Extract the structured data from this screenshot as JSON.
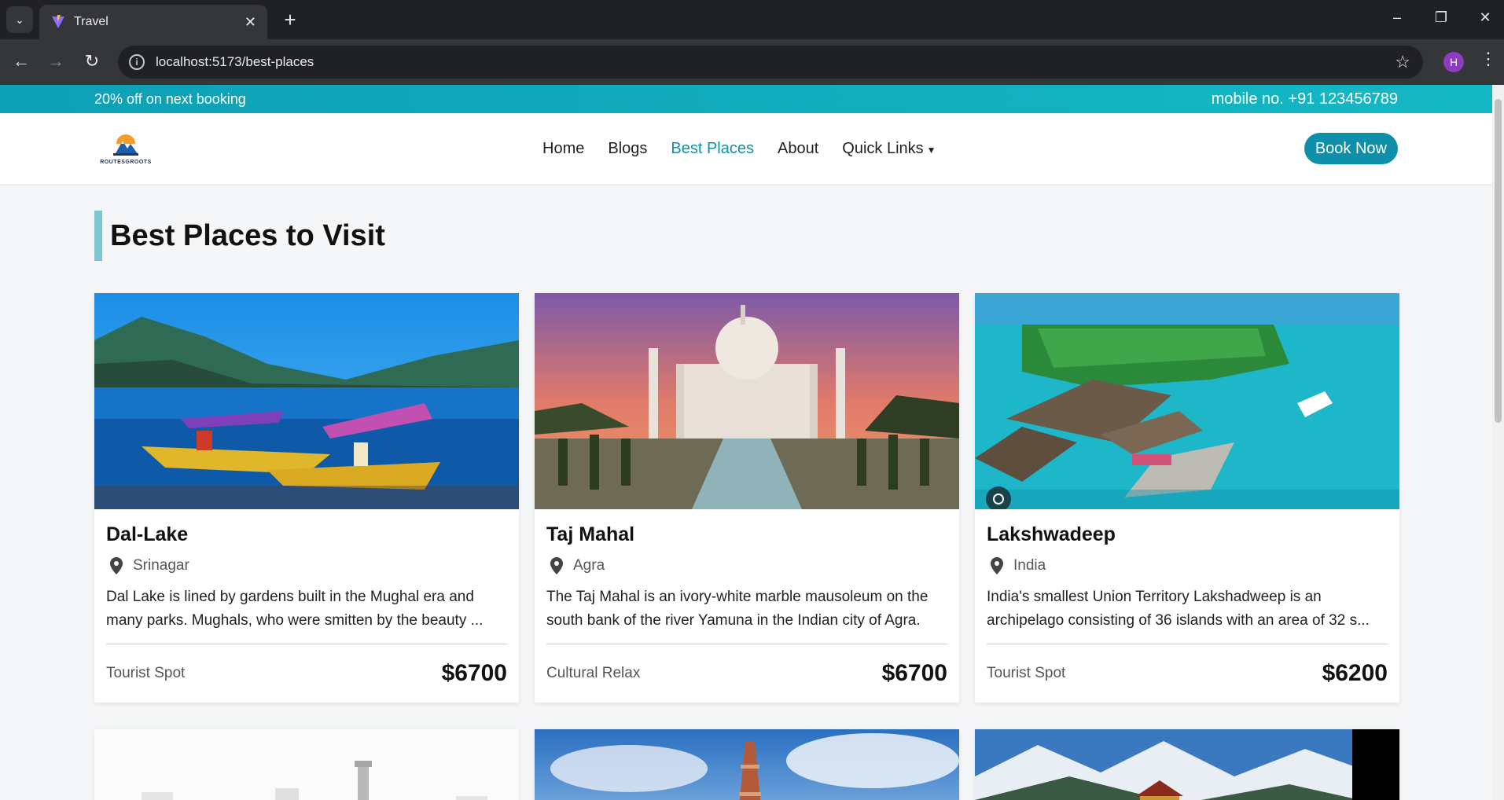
{
  "browser": {
    "tab_title": "Travel",
    "url": "localhost:5173/best-places",
    "profile_initial": "H"
  },
  "promo": {
    "offer": "20% off on next booking",
    "phone": "mobile no. +91 123456789"
  },
  "nav": {
    "logo_text": "ROUTESGROOTS",
    "items": [
      {
        "label": "Home"
      },
      {
        "label": "Blogs"
      },
      {
        "label": "Best Places"
      },
      {
        "label": "About"
      },
      {
        "label": "Quick Links"
      }
    ],
    "book_label": "Book Now"
  },
  "page": {
    "title": "Best Places to Visit"
  },
  "places": [
    {
      "name": "Dal-Lake",
      "location": "Srinagar",
      "description": "Dal Lake is lined by gardens built in the Mughal era and many parks. Mughals, who were smitten by the beauty ...",
      "category": "Tourist Spot",
      "price": "$6700"
    },
    {
      "name": "Taj Mahal",
      "location": "Agra",
      "description": "The Taj Mahal is an ivory-white marble mausoleum on the south bank of the river Yamuna in the Indian city of Agra.",
      "category": "Cultural Relax",
      "price": "$6700"
    },
    {
      "name": "Lakshwadeep",
      "location": "India",
      "description": "India's smallest Union Territory Lakshadweep is an archipelago consisting of 36 islands with an area of 32 s...",
      "category": "Tourist Spot",
      "price": "$6200"
    }
  ],
  "colors": {
    "accent": "#0e90aa",
    "promo_bar": "#14b8c4",
    "heading_bar": "#7cc6d2"
  }
}
